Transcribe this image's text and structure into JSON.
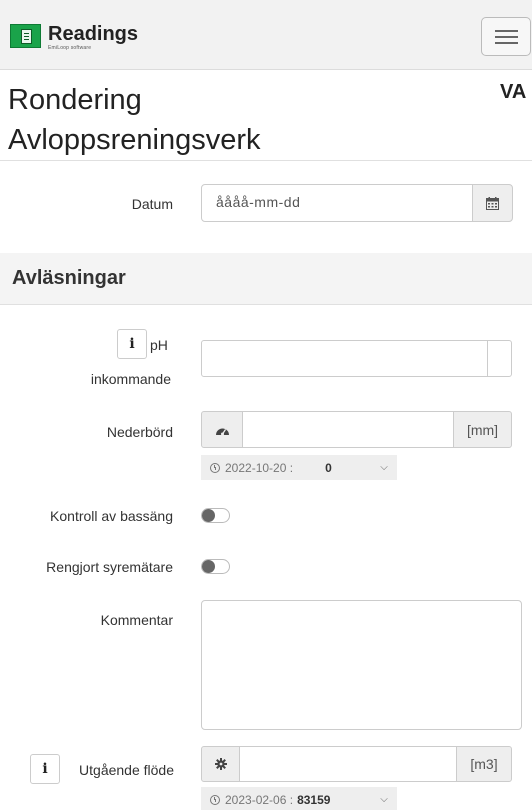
{
  "header": {
    "brand_name": "Readings",
    "brand_sub": "EmiLoop software",
    "logo_icon": "readings-logo-icon",
    "menu_icon": "hamburger-menu-icon"
  },
  "page": {
    "title_line1": "Rondering",
    "title_line2": "Avloppsreningsverk",
    "title_right": "VA"
  },
  "datum": {
    "label": "Datum",
    "placeholder": "åååå-mm-dd",
    "icon": "calendar-icon"
  },
  "section": {
    "title": "Avläsningar"
  },
  "fields": {
    "ph": {
      "label_line1": "pH",
      "label_line2": "inkommande",
      "info": "i"
    },
    "nederbord": {
      "label": "Nederbörd",
      "icon": "gauge-icon",
      "unit": "[mm]",
      "last_date": "2022-10-20 :",
      "last_value": "0"
    },
    "kontroll": {
      "label": "Kontroll av bassäng"
    },
    "rengjort": {
      "label": "Rengjort syremätare"
    },
    "kommentar": {
      "label": "Kommentar"
    },
    "utgaende": {
      "label": "Utgående flöde",
      "info": "i",
      "icon": "gear-icon",
      "unit": "[m3]",
      "last_date": "2023-02-06 :",
      "last_value": "83159"
    }
  },
  "colors": {
    "brand_green": "#1aa34a",
    "navbar_bg": "#f2f2f2",
    "section_bg": "#f4f4f4"
  }
}
